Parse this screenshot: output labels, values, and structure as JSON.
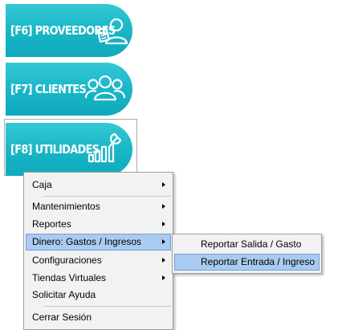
{
  "buttons": {
    "proveedores": "[F6] PROVEEDORES",
    "clientes": "[F7] CLIENTES",
    "utilidades": "[F8] UTILIDADES"
  },
  "menu": {
    "items": [
      {
        "label": "Caja",
        "submenu": true
      },
      {
        "label": "Mantenimientos",
        "submenu": true
      },
      {
        "label": "Reportes",
        "submenu": true
      },
      {
        "label": "Dinero: Gastos / Ingresos",
        "submenu": true,
        "highlighted": true
      },
      {
        "label": "Configuraciones",
        "submenu": true
      },
      {
        "label": "Tiendas Virtuales",
        "submenu": true
      },
      {
        "label": "Solicitar Ayuda",
        "submenu": false
      },
      {
        "label": "Cerrar Sesión",
        "submenu": false
      }
    ]
  },
  "submenu": {
    "items": [
      {
        "label": "Reportar Salida / Gasto"
      },
      {
        "label": "Reportar Entrada / Ingreso",
        "highlighted": true
      }
    ]
  },
  "colors": {
    "button": "#17b5c6",
    "highlight": "#a9cbf0",
    "highlight_border": "#6f9fd8",
    "menu_bg": "#f2f2f2"
  },
  "icons": [
    "supplier-icon",
    "clients-icon",
    "utilities-icon",
    "submenu-arrow-icon"
  ]
}
